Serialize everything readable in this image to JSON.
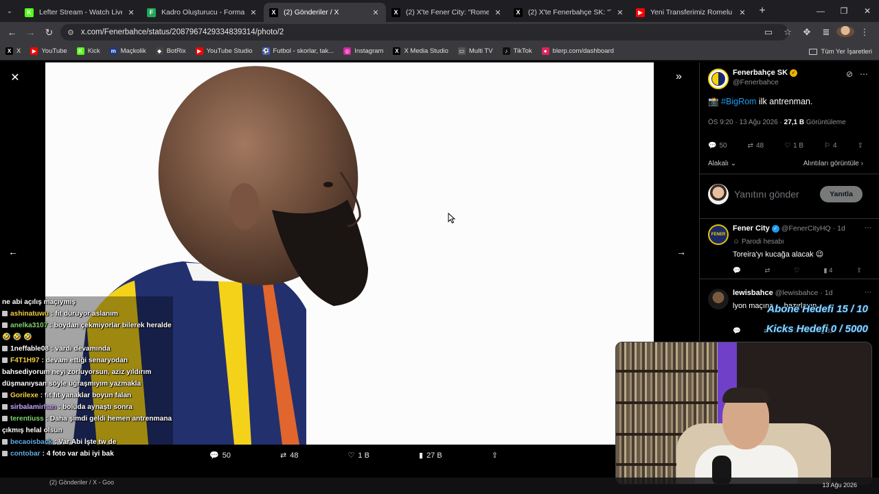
{
  "browser": {
    "tabs": [
      {
        "title": "Lefter Stream - Watch Live on K",
        "fav_color": "#53fc18",
        "fav_glyph": "K",
        "active": false
      },
      {
        "title": "Kadro Oluşturucu - Formasyonl",
        "fav_color": "#1fa85a",
        "fav_glyph": "F",
        "active": false
      },
      {
        "title": "(2) Gönderiler / X",
        "fav_color": "#000000",
        "fav_glyph": "X",
        "active": true
      },
      {
        "title": "(2) X'te Fener City: \"Romelu Göl",
        "fav_color": "#000000",
        "fav_glyph": "X",
        "active": false
      },
      {
        "title": "(2) X'te Fenerbahçe SK: \"Teşekk",
        "fav_color": "#000000",
        "fav_glyph": "X",
        "active": false
      },
      {
        "title": "Yeni Transferimiz Romelu Lukak",
        "fav_color": "#ff0000",
        "fav_glyph": "▶",
        "active": false
      }
    ],
    "url": "x.com/Fenerbahce/status/2087967429334839314/photo/2",
    "bookmarks": [
      {
        "label": "X",
        "color": "#000000",
        "glyph": "X"
      },
      {
        "label": "YouTube",
        "color": "#ff0000",
        "glyph": "▶"
      },
      {
        "label": "Kick",
        "color": "#53fc18",
        "glyph": "K"
      },
      {
        "label": "Maçkolik",
        "color": "#1a3a8a",
        "glyph": "m"
      },
      {
        "label": "BotRix",
        "color": "#444444",
        "glyph": "◆"
      },
      {
        "label": "YouTube Studio",
        "color": "#ff0000",
        "glyph": "▶"
      },
      {
        "label": "Futbol - skorlar, tak...",
        "color": "#3a5fd6",
        "glyph": "⚽"
      },
      {
        "label": "Instagram",
        "color": "#d6249f",
        "glyph": "◎"
      },
      {
        "label": "X Media Studio",
        "color": "#000000",
        "glyph": "X"
      },
      {
        "label": "Multi TV",
        "color": "#555555",
        "glyph": "▭"
      },
      {
        "label": "TikTok",
        "color": "#111111",
        "glyph": "♪"
      },
      {
        "label": "blerp.com/dashboard",
        "color": "#e0245e",
        "glyph": "●"
      }
    ],
    "all_bookmarks_label": "Tüm Yer İşaretleri"
  },
  "photo_actions": {
    "replies": "50",
    "reposts": "48",
    "likes": "1 B",
    "views": "27 B"
  },
  "tweet": {
    "author_name": "Fenerbahçe SK",
    "author_handle": "@Fenerbahce",
    "emoji": "📸",
    "hashtag": "#BigRom",
    "text": " ilk antrenman.",
    "time": "ÖS 9:20 · 13 Ağu 2026 · ",
    "views_count": "27,1 B",
    "views_label": " Görüntüleme",
    "replies": "50",
    "reposts": "48",
    "likes": "1 B",
    "bookmarks": "4",
    "relevant_label": "Alakalı",
    "quotes_label": "Alıntıları görüntüle",
    "reply_placeholder": "Yanıtını gönder",
    "reply_button": "Yanıtla"
  },
  "replies": [
    {
      "name": "Fener City",
      "handle": "@FenerCityHQ",
      "age": "· 1d",
      "sub": "Parodi hesabı",
      "text": "Toreira'yı kucağa alacak 😉",
      "views": "4"
    },
    {
      "name": "lewisbahce",
      "handle": "@lewisbahce",
      "age": "· 1d",
      "text": "lyon maçına ... hazırlayın",
      "views": "32"
    }
  ],
  "overlay": {
    "goal_subs": "Abone Hedefi 15 / 10",
    "goal_kicks": "Kicks Hedefi 0 / 5000"
  },
  "chat": [
    {
      "user": "",
      "color": "#ffffff",
      "msg": "ne abi açılış maçıymış"
    },
    {
      "user": "ashinatuwu",
      "color": "#f4d03f",
      "msg": ": fit duruyor aslanım"
    },
    {
      "user": "anelka3107",
      "color": "#7fd36b",
      "msg": ": boydan çekmiyorlar bilerek heralde 🤣 🤣 🤣"
    },
    {
      "user": "1neffable08",
      "color": "#ffffff",
      "msg": ": vardı devamında"
    },
    {
      "user": "F4T1H97",
      "color": "#f4d03f",
      "msg": ": devam ettiği senaryodan bahsediyorum neyi zorluyorsun, aziz yıldırım düşmanıysan söyle uğraşmıyım yazmakla"
    },
    {
      "user": "Gorilexe",
      "color": "#f4d03f",
      "msg": ": fit fit yanaklar boyun falan"
    },
    {
      "user": "sirbalamirhan",
      "color": "#c9a4ff",
      "msg": ": boluda aynaştı sonra"
    },
    {
      "user": "terentiuss",
      "color": "#7fd36b",
      "msg": ": Daha şimdi geldi hemen antrenmana çıkmış helal olsun"
    },
    {
      "user": "becaoisback",
      "color": "#5dade2",
      "msg": ": Var Abi İşte tw de"
    },
    {
      "user": "contobar",
      "color": "#5dade2",
      "msg": ": 4 foto var abi iyi bak"
    }
  ],
  "taskbar": {
    "item": "(2) Gönderiler / X - Goo",
    "date": "13 Ağu 2026"
  }
}
